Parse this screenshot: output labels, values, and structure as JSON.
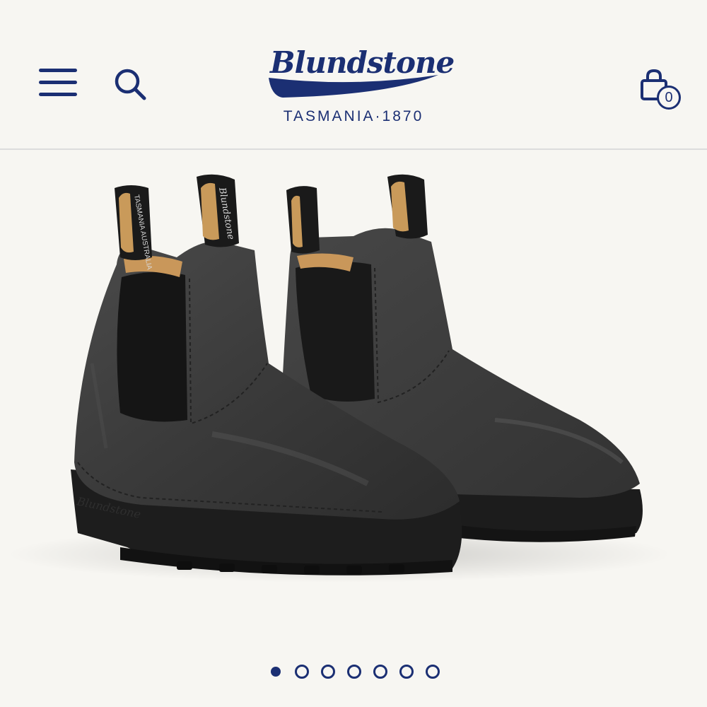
{
  "header": {
    "brand_name": "Blundstone",
    "tagline": "TASMANIA·1870",
    "cart_count": "0",
    "menu_icon": "hamburger-menu-icon",
    "search_icon": "search-icon",
    "cart_icon": "shopping-bag-icon"
  },
  "product": {
    "heel_tab_text_a": "TASMANIA AUSTRALIA",
    "heel_tab_text_b": "Blundstone"
  },
  "carousel": {
    "total_slides": 7,
    "active_index": 0
  },
  "colors": {
    "brand_navy": "#1b2f73",
    "background": "#f7f6f2",
    "boot_leather": "#3e3e3e",
    "sole": "#1c1c1c"
  }
}
